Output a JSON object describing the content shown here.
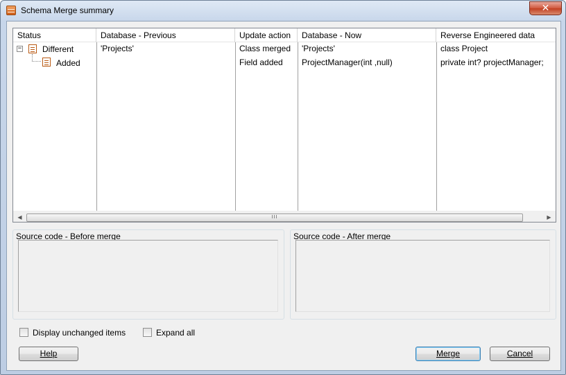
{
  "window": {
    "title": "Schema Merge summary",
    "close_glyph": "✕"
  },
  "grid": {
    "columns": [
      "Status",
      "Database - Previous",
      "Update action",
      "Database - Now",
      "Reverse Engineered data"
    ],
    "rows": [
      {
        "status": "Different",
        "expander": "−",
        "db_previous": "'Projects'",
        "update_action": "Class merged",
        "db_now": "'Projects'",
        "reverse": "class Project"
      },
      {
        "status": "Added",
        "db_previous": "",
        "update_action": "Field added",
        "db_now": "ProjectManager(int ,null)",
        "reverse": "private int? projectManager;"
      }
    ],
    "scrollbar": {
      "left_arrow": "◀",
      "right_arrow": "▶",
      "thumb_grip": "III"
    }
  },
  "panels": {
    "before_label": "Source code - Before merge",
    "after_label": "Source code - After merge"
  },
  "options": {
    "display_unchanged": "Display unchanged items",
    "expand_all": "Expand all",
    "display_unchanged_checked": false,
    "expand_all_checked": false
  },
  "buttons": {
    "help": "Help",
    "merge": "Merge",
    "cancel": "Cancel"
  }
}
